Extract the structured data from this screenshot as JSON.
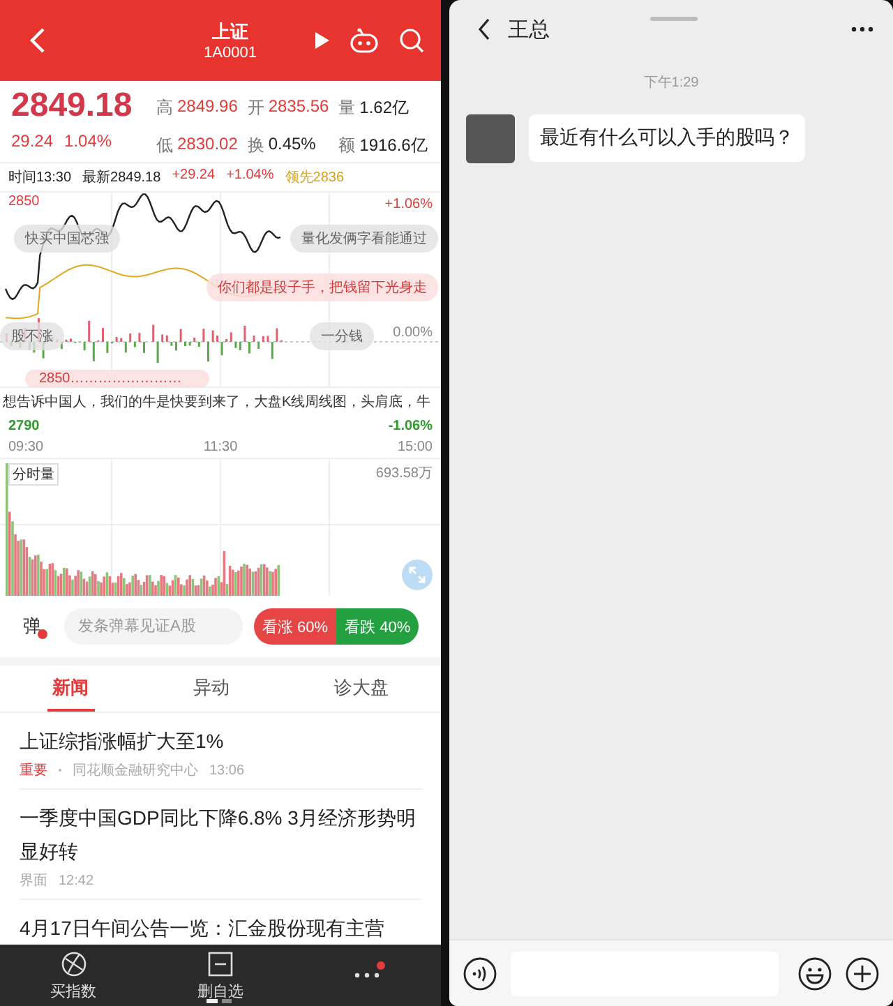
{
  "stock_app": {
    "header": {
      "title": "上证",
      "code": "1A0001"
    },
    "quote": {
      "price": "2849.18",
      "change": "29.24",
      "change_pct": "1.04%",
      "stats": [
        {
          "label": "高",
          "value": "2849.96",
          "kind": "up"
        },
        {
          "label": "开",
          "value": "2835.56",
          "kind": "up"
        },
        {
          "label": "量",
          "value": "1.62亿",
          "kind": "plain"
        },
        {
          "label": "低",
          "value": "2830.02",
          "kind": "up"
        },
        {
          "label": "换",
          "value": "0.45%",
          "kind": "plain"
        },
        {
          "label": "额",
          "value": "1916.6亿",
          "kind": "plain"
        }
      ]
    },
    "info_line": [
      {
        "text": "时间13:30",
        "kind": "plain"
      },
      {
        "text": "最新2849.18",
        "kind": "plain"
      },
      {
        "text": "+29.24",
        "kind": "up"
      },
      {
        "text": "+1.04%",
        "kind": "up"
      },
      {
        "text": "领先2836",
        "kind": "lead"
      }
    ],
    "chart": {
      "top_price": "2850",
      "top_pct": "+1.06%",
      "mid_pct": "0.00%",
      "bottom_price": "2790",
      "bottom_pct": "-1.06%",
      "times": [
        "09:30",
        "11:30",
        "15:00"
      ]
    },
    "danmaku": [
      {
        "text": "快买中国芯强",
        "kind": "grey"
      },
      {
        "text": "量化发俩字看能通过",
        "kind": "grey"
      },
      {
        "text": "你们都是段子手，把钱留下光身走",
        "kind": "pink"
      },
      {
        "text": "股不涨",
        "kind": "grey"
      },
      {
        "text": "一分钱",
        "kind": "grey"
      },
      {
        "text": "2850……………………",
        "kind": "pink"
      }
    ],
    "ticker": "想告诉中国人，我们的牛是快要到来了，大盘K线周线图，头肩底，牛",
    "volume": {
      "label": "分时量",
      "max": "693.58万"
    },
    "comment_bar": {
      "badge": "弹",
      "placeholder": "发条弹幕见证A股",
      "votes": [
        {
          "label": "看涨 60%",
          "kind": "up"
        },
        {
          "label": "看跌 40%",
          "kind": "down"
        }
      ]
    },
    "tabs": [
      {
        "label": "新闻",
        "selected": true
      },
      {
        "label": "异动",
        "selected": false
      },
      {
        "label": "诊大盘",
        "selected": false
      }
    ],
    "news": [
      {
        "title": "上证综指涨幅扩大至1%",
        "tag": "重要",
        "source": "同花顺金融研究中心",
        "time": "13:06"
      },
      {
        "title": "一季度中国GDP同比下降6.8% 3月经济形势明显好转",
        "source": "界面",
        "time": "12:42"
      },
      {
        "title": "4月17日午间公告一览：汇金股份现有主营"
      }
    ],
    "bottom_bar": [
      {
        "label": "买指数",
        "kind": "ball"
      },
      {
        "label": "删自选",
        "kind": "minus"
      },
      {
        "kind": "more",
        "badge": true
      }
    ]
  },
  "chat": {
    "title": "王总",
    "messages": [
      {
        "time": "下午1:29",
        "text": "最近有什么可以入手的股吗？"
      }
    ]
  }
}
